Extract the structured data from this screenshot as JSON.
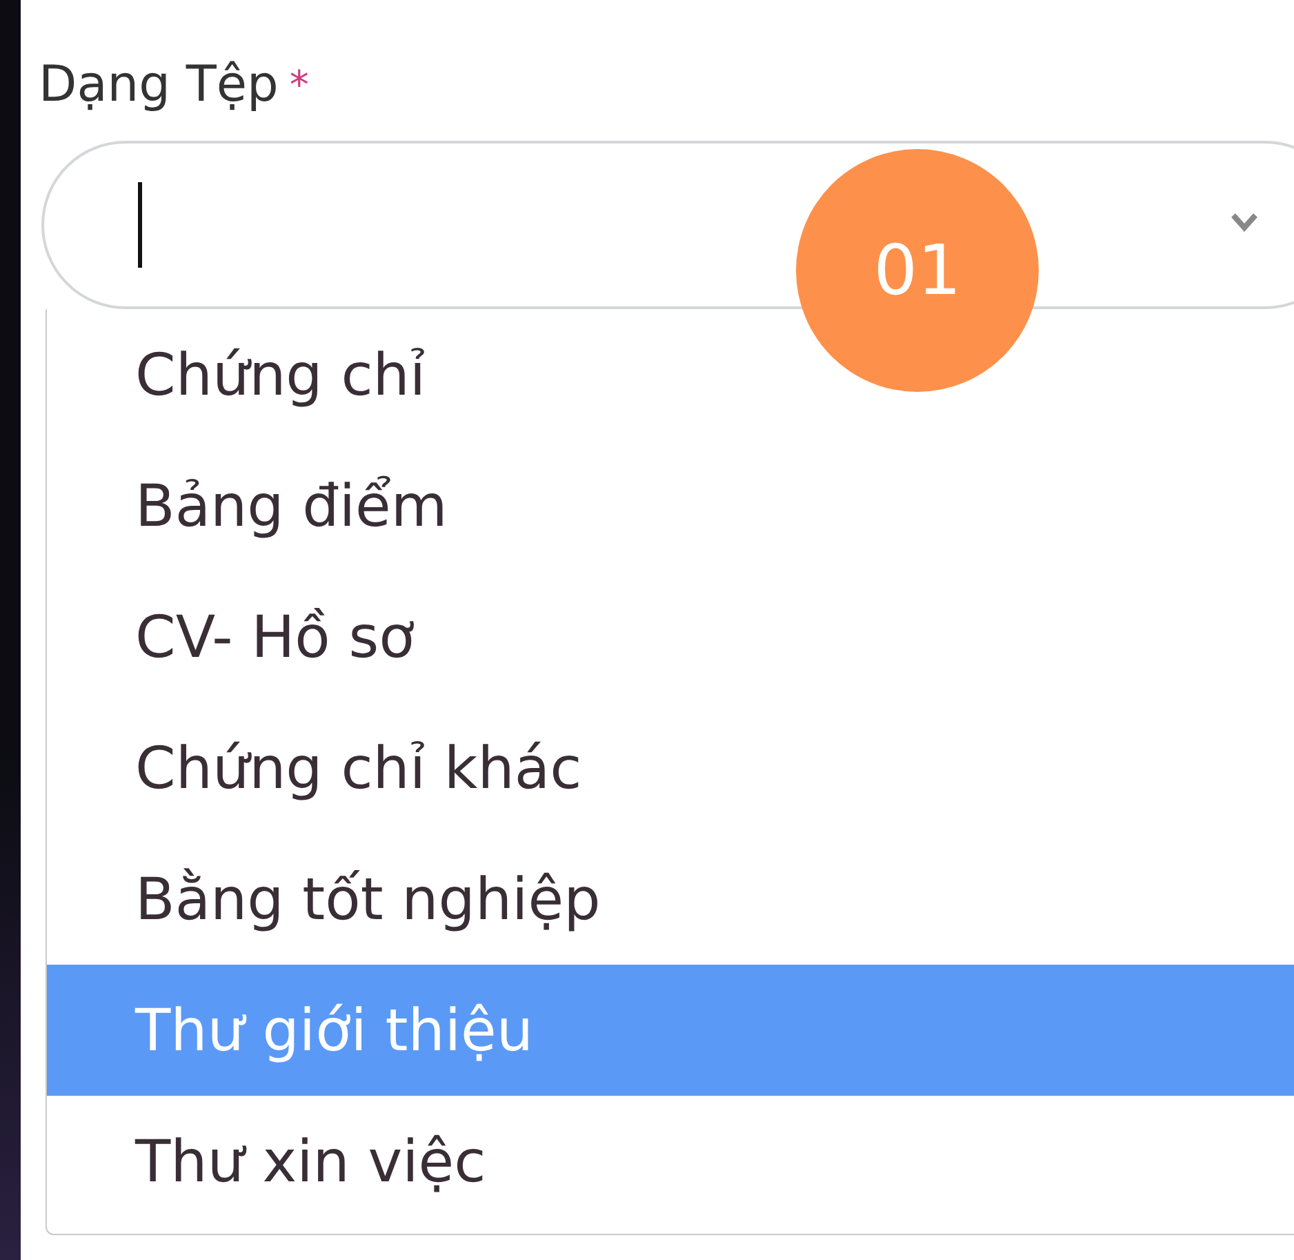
{
  "field": {
    "label": "Dạng Tệp",
    "required_mark": "*"
  },
  "badge": {
    "text": "01"
  },
  "options": [
    {
      "label": "Chứng chỉ",
      "selected": false
    },
    {
      "label": "Bảng điểm",
      "selected": false
    },
    {
      "label": "CV- Hồ sơ",
      "selected": false
    },
    {
      "label": "Chứng chỉ khác",
      "selected": false
    },
    {
      "label": "Bằng tốt nghiệp",
      "selected": false
    },
    {
      "label": "Thư giới thiệu",
      "selected": true
    },
    {
      "label": "Thư xin việc",
      "selected": false
    }
  ]
}
